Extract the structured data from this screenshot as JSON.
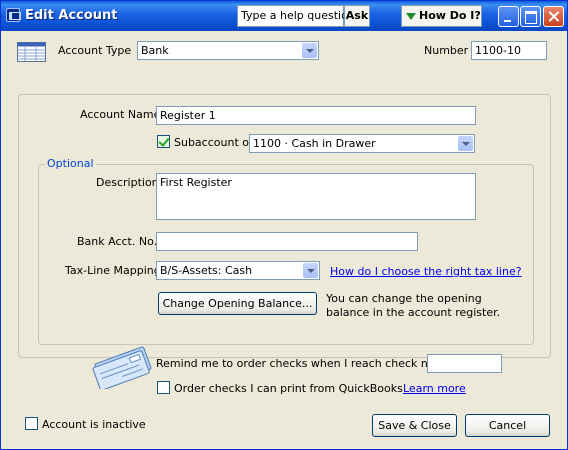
{
  "window": {
    "title": "Edit Account"
  },
  "help": {
    "question_placeholder": "Type a help question",
    "ask_label": "Ask",
    "howdo_label": "How Do I?"
  },
  "account": {
    "type_label": "Account Type",
    "type_value": "Bank",
    "number_label": "Number",
    "number_value": "1100-10",
    "name_label": "Account Name",
    "name_value": "Register 1",
    "subaccount_label": "Subaccount of",
    "subaccount_checked": true,
    "subaccount_value": "1100 · Cash in Drawer"
  },
  "optional": {
    "legend": "Optional",
    "description_label": "Description",
    "description_value": "First Register",
    "bank_acct_label": "Bank Acct. No.",
    "bank_acct_value": "",
    "taxline_label": "Tax-Line Mapping",
    "taxline_value": "B/S-Assets: Cash",
    "taxline_help_link": "How do I choose the right tax line?",
    "opening_balance_button": "Change Opening Balance...",
    "opening_balance_note": "You can change the opening balance in the account register."
  },
  "checks": {
    "remind_label": "Remind me to order checks when I reach check number",
    "remind_value": "",
    "order_label": "Order checks I can print from QuickBooks",
    "order_checked": false,
    "learn_more": "Learn more"
  },
  "footer": {
    "inactive_label": "Account is inactive",
    "inactive_checked": false,
    "save_close": "Save & Close",
    "cancel": "Cancel"
  },
  "icons": {
    "title_icon": "quickbooks-app-icon",
    "account_icon": "register-ledger-icon",
    "check_icon": "check-book-icon"
  }
}
